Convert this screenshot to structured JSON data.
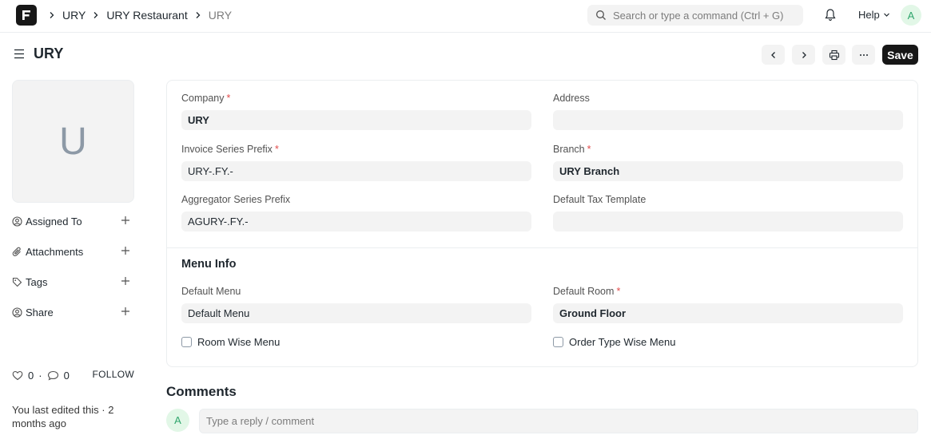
{
  "navbar": {
    "breadcrumbs": [
      "URY",
      "URY Restaurant",
      "URY"
    ],
    "search_placeholder": "Search or type a command (Ctrl + G)",
    "help_label": "Help",
    "user_initial": "A"
  },
  "page": {
    "title": "URY",
    "save_label": "Save"
  },
  "sidebar": {
    "image_initial": "U",
    "items": [
      {
        "label": "Assigned To",
        "icon": "assign-icon"
      },
      {
        "label": "Attachments",
        "icon": "paperclip-icon"
      },
      {
        "label": "Tags",
        "icon": "tag-icon"
      },
      {
        "label": "Share",
        "icon": "share-icon"
      }
    ],
    "likes": "0",
    "comments_count": "0",
    "follow_label": "FOLLOW",
    "last_edited": "You last edited this · 2 months ago"
  },
  "form": {
    "fields": {
      "company": {
        "label": "Company",
        "value": "URY",
        "required": "*"
      },
      "address": {
        "label": "Address",
        "value": ""
      },
      "invoice_series_prefix": {
        "label": "Invoice Series Prefix",
        "value": "URY-.FY.-",
        "required": "*"
      },
      "branch": {
        "label": "Branch",
        "value": "URY Branch",
        "required": "*"
      },
      "aggregator_series_prefix": {
        "label": "Aggregator Series Prefix",
        "value": "AGURY-.FY.-"
      },
      "default_tax_template": {
        "label": "Default Tax Template",
        "value": ""
      }
    },
    "menu_section": {
      "title": "Menu Info",
      "default_menu": {
        "label": "Default Menu",
        "value": "Default Menu"
      },
      "default_room": {
        "label": "Default Room",
        "value": "Ground Floor",
        "required": "*"
      },
      "room_wise_menu": {
        "label": "Room Wise Menu",
        "checked": false
      },
      "order_type_wise_menu": {
        "label": "Order Type Wise Menu",
        "checked": false
      }
    }
  },
  "comments": {
    "title": "Comments",
    "avatar_initial": "A",
    "placeholder": "Type a reply / comment"
  },
  "colors": {
    "primary_button": "#171717",
    "required_marker": "#e24c4c",
    "avatar_bg": "#e2f7e7",
    "avatar_text": "#30a66d"
  }
}
